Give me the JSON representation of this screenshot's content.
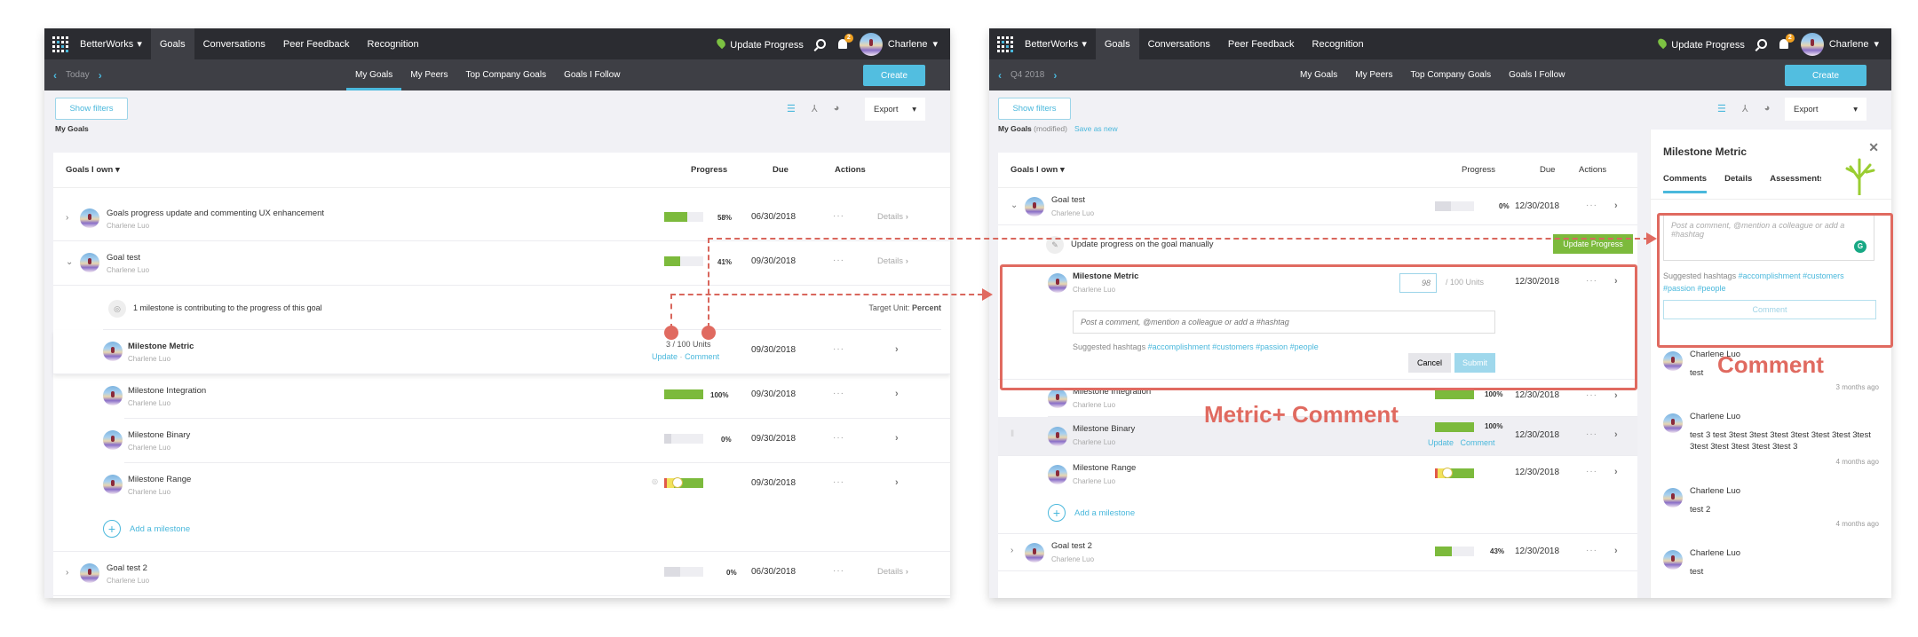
{
  "app": {
    "brand": "BetterWorks",
    "nav": [
      "Goals",
      "Conversations",
      "Peer Feedback",
      "Recognition"
    ],
    "update_progress": "Update Progress",
    "notification_count": "2",
    "user": "Charlene",
    "subtabs": [
      "My Goals",
      "My Peers",
      "Top Company Goals",
      "Goals I Follow"
    ],
    "create": "Create",
    "show_filters": "Show filters",
    "export": "Export",
    "goals_filter": "Goals I own",
    "col_progress": "Progress",
    "col_due": "Due",
    "col_actions": "Actions",
    "details": "Details",
    "owner": "Charlene Luo",
    "dots": "···",
    "add_milestone": "Add a milestone",
    "update": "Update",
    "comment": "Comment"
  },
  "left": {
    "period": "Today",
    "my_goals": "My Goals",
    "goals": [
      {
        "title": "Goals progress update and commenting UX enhancement",
        "progress": 58,
        "pct": "58%",
        "due": "06/30/2018"
      },
      {
        "title": "Goal test",
        "progress": 41,
        "pct": "41%",
        "due": "09/30/2018"
      }
    ],
    "milestone_info": "1 milestone is contributing to the progress of this goal",
    "target_unit_label": "Target Unit:",
    "target_unit_value": "Percent",
    "milestones": [
      {
        "title": "Milestone Metric",
        "value": "3 / 100 Units",
        "due": "09/30/2018"
      },
      {
        "title": "Milestone Integration",
        "progress": 100,
        "pct": "100%",
        "due": "09/30/2018"
      },
      {
        "title": "Milestone Binary",
        "progress": 0,
        "pct": "0%",
        "due": "09/30/2018"
      },
      {
        "title": "Milestone Range",
        "due": "09/30/2018"
      }
    ],
    "goal3": {
      "title": "Goal test 2",
      "progress": 0,
      "pct": "0%",
      "due": "06/30/2018"
    }
  },
  "right": {
    "period": "Q4 2018",
    "my_goals": "My Goals",
    "modified": "(modified)",
    "save_as_new": "Save as new",
    "goal": {
      "title": "Goal test",
      "progress": 0,
      "pct": "0%",
      "due": "12/30/2018"
    },
    "manual_text": "Update progress on the goal manually",
    "update_progress_btn": "Update Progress",
    "metric": {
      "title": "Milestone Metric",
      "input_value": "98",
      "units": "/ 100 Units",
      "due": "12/30/2018"
    },
    "comment_placeholder": "Post a comment, @mention a colleague or add a #hashtag",
    "suggested": "Suggested hashtags",
    "hashtags": "#accomplishment #customers #passion #people",
    "cancel": "Cancel",
    "submit": "Submit",
    "milestones": [
      {
        "title": "Milestone Integration",
        "progress": 100,
        "pct": "100%",
        "due": "12/30/2018"
      },
      {
        "title": "Milestone Binary",
        "progress": 100,
        "pct": "100%",
        "due": "12/30/2018"
      },
      {
        "title": "Milestone Range",
        "due": "12/30/2018"
      }
    ],
    "goal2": {
      "title": "Goal test 2",
      "progress": 43,
      "pct": "43%",
      "due": "12/30/2018"
    },
    "panel": {
      "title": "Milestone Metric",
      "tabs": [
        "Comments",
        "Details",
        "Assessments"
      ],
      "placeholder": "Post a comment, @mention a colleague or add a #hashtag",
      "suggested": "Suggested hashtags",
      "hashtags": "#accomplishment #customers #passion #people",
      "comment_btn": "Comment",
      "comments": [
        {
          "author": "Charlene Luo",
          "text": "test",
          "time": "3 months ago"
        },
        {
          "author": "Charlene Luo",
          "text": "test 3 test 3test 3test 3test 3test 3test 3test 3test 3test 3test 3test 3test 3test 3",
          "time": "4 months ago"
        },
        {
          "author": "Charlene Luo",
          "text": "test 2",
          "time": "4 months ago"
        },
        {
          "author": "Charlene Luo",
          "text": "test",
          "time": ""
        }
      ]
    }
  },
  "annotations": {
    "metric_comment": "Metric+ Comment",
    "comment": "Comment"
  }
}
